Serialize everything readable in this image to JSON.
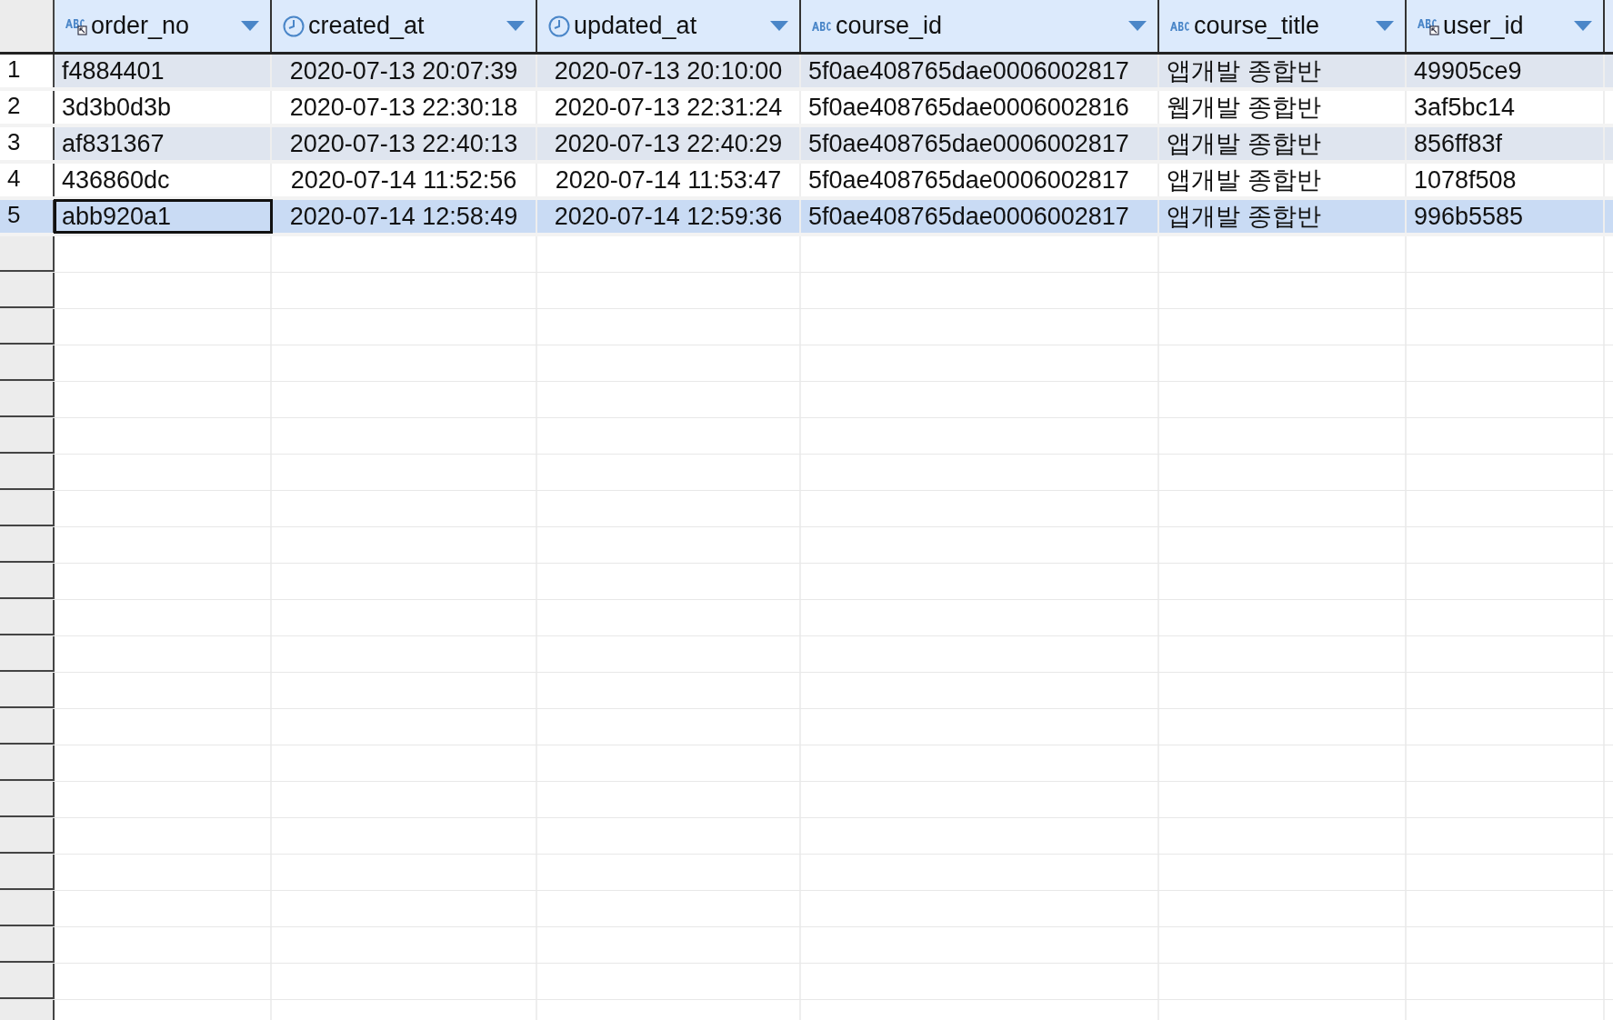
{
  "table": {
    "columns": [
      {
        "name": "order_no",
        "kind": "text-key"
      },
      {
        "name": "created_at",
        "kind": "datetime"
      },
      {
        "name": "updated_at",
        "kind": "datetime"
      },
      {
        "name": "course_id",
        "kind": "text"
      },
      {
        "name": "course_title",
        "kind": "text"
      },
      {
        "name": "user_id",
        "kind": "text-key"
      }
    ],
    "rows": [
      {
        "number": "1",
        "selected": false,
        "focused": false,
        "cells": [
          "f4884401",
          "2020-07-13 20:07:39",
          "2020-07-13 20:10:00",
          "5f0ae408765dae0006002817",
          "앱개발 종합반",
          "49905ce9"
        ]
      },
      {
        "number": "2",
        "selected": false,
        "focused": false,
        "cells": [
          "3d3b0d3b",
          "2020-07-13 22:30:18",
          "2020-07-13 22:31:24",
          "5f0ae408765dae0006002816",
          "웹개발 종합반",
          "3af5bc14"
        ]
      },
      {
        "number": "3",
        "selected": false,
        "focused": false,
        "cells": [
          "af831367",
          "2020-07-13 22:40:13",
          "2020-07-13 22:40:29",
          "5f0ae408765dae0006002817",
          "앱개발 종합반",
          "856ff83f"
        ]
      },
      {
        "number": "4",
        "selected": false,
        "focused": false,
        "cells": [
          "436860dc",
          "2020-07-14 11:52:56",
          "2020-07-14 11:53:47",
          "5f0ae408765dae0006002817",
          "앱개발 종합반",
          "1078f508"
        ]
      },
      {
        "number": "5",
        "selected": true,
        "focused": true,
        "cells": [
          "abb920a1",
          "2020-07-14 12:58:49",
          "2020-07-14 12:59:36",
          "5f0ae408765dae0006002817",
          "앱개발 종합반",
          "996b5585"
        ]
      }
    ]
  }
}
